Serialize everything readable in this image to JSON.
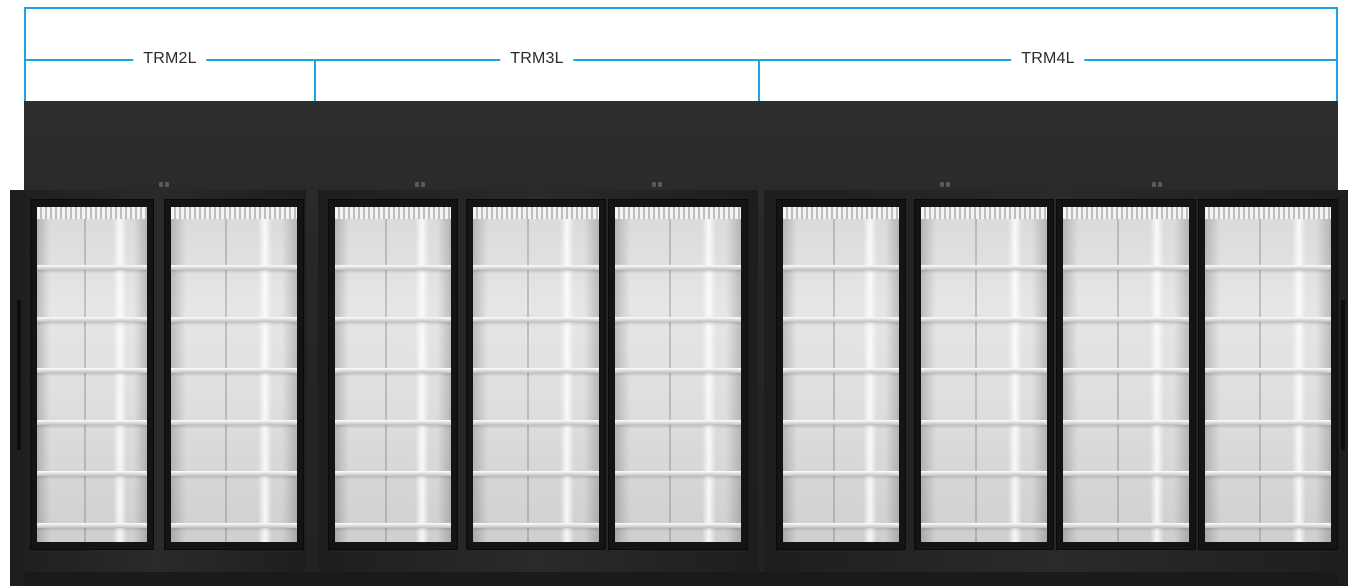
{
  "image": {
    "subject": "Row of glass-door refrigerated display cases",
    "labels": [
      {
        "id": "trm2l",
        "text": "TRM2L",
        "doors": 2
      },
      {
        "id": "trm3l",
        "text": "TRM3L",
        "doors": 3
      },
      {
        "id": "trm4l",
        "text": "TRM4L",
        "doors": 4
      }
    ],
    "colors": {
      "dimension_line": "#1aa6e0",
      "case_body": "#2b2b2b",
      "interior": "#e0e0e0",
      "label_text": "#2b2b2b"
    },
    "shelves_per_door": 6
  }
}
